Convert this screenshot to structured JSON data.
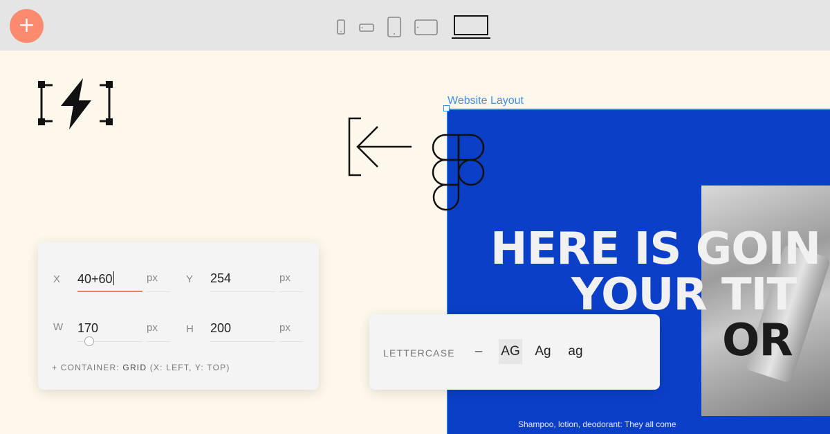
{
  "toolbar": {
    "add_label": "+",
    "devices": [
      {
        "icon": "phone-portrait-icon",
        "selected": false
      },
      {
        "icon": "phone-landscape-icon",
        "selected": false
      },
      {
        "icon": "tablet-portrait-icon",
        "selected": false
      },
      {
        "icon": "tablet-landscape-icon",
        "selected": false
      },
      {
        "icon": "laptop-icon",
        "selected": true
      }
    ]
  },
  "decorations": [
    "lightning-bolt-frame-icon",
    "import-arrow-icon",
    "figma-logo-icon"
  ],
  "frame": {
    "label": "Website Layout",
    "headline_line1": "HERE IS GOIN",
    "headline_line2": "YOUR TIT",
    "headline_line3": "OR",
    "caption": "Shampoo, lotion, deodorant: They all come",
    "background": "#0b3fc8"
  },
  "position_panel": {
    "x_label": "X",
    "x_value": "40+60",
    "x_unit": "px",
    "y_label": "Y",
    "y_value": "254",
    "y_unit": "px",
    "w_label": "W",
    "w_value": "170",
    "w_unit": "px",
    "h_label": "H",
    "h_value": "200",
    "h_unit": "px",
    "container_prefix": "+ CONTAINER:",
    "container_value": "GRID",
    "container_detail": "(X: LEFT, Y: TOP)"
  },
  "lettercase_panel": {
    "label": "LETTERCASE",
    "options": [
      "–",
      "AG",
      "Ag",
      "ag"
    ],
    "selected": "AG"
  },
  "colors": {
    "accent": "#fb8a6f",
    "selection": "#2f8fe8",
    "canvas": "#fdf7ec"
  }
}
